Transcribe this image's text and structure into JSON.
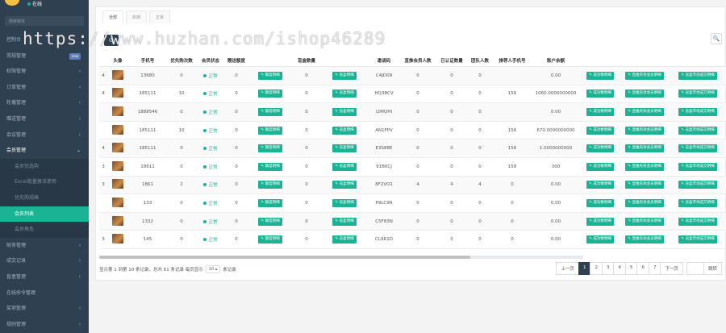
{
  "sidebar": {
    "status": "在线",
    "search_placeholder": "搜索菜单",
    "items": [
      {
        "label": "控制台",
        "arrow": ""
      },
      {
        "label": "常规管理",
        "badge": "new"
      },
      {
        "label": "权限管理",
        "arrow": "‹"
      },
      {
        "label": "订单管理",
        "arrow": "‹"
      },
      {
        "label": "轮播管理",
        "arrow": "‹"
      },
      {
        "label": "赠送管理",
        "arrow": "‹"
      },
      {
        "label": "会议管理",
        "arrow": "‹"
      },
      {
        "label": "会员管理",
        "arrow": "⌄",
        "open": true
      },
      {
        "label": "会员优选购",
        "sub": true
      },
      {
        "label": "Excel批量激活使用",
        "sub": true
      },
      {
        "label": "优先购规格",
        "sub": true
      },
      {
        "label": "会员列表",
        "sub": true,
        "active": true
      },
      {
        "label": "会员角色",
        "sub": true
      },
      {
        "label": "财务管理",
        "arrow": "‹"
      },
      {
        "label": "成交记录",
        "arrow": "‹"
      },
      {
        "label": "盲盒管理",
        "arrow": "‹"
      },
      {
        "label": "在线命令管理",
        "arrow": ""
      },
      {
        "label": "奖项管理",
        "arrow": "‹"
      },
      {
        "label": "规则管理",
        "arrow": "‹"
      }
    ]
  },
  "tabs": [
    "全部",
    "启用",
    "正常"
  ],
  "watermark": "https://www.huzhan.com/ishop46289",
  "table": {
    "headers": [
      "头像",
      "手机号",
      "优先购次数",
      "会员状态",
      "赠送额度",
      "",
      "盲盒数量",
      "",
      "邀请码",
      "直推会员人数",
      "已认证数量",
      "团队人数",
      "推荐人手机号",
      "账户余额",
      "",
      "",
      ""
    ],
    "buttons": {
      "quota": "额度明细",
      "box": "盲盒明细",
      "success": "成功数明细",
      "direct": "直推有效会员明细",
      "blindrec": "盲盒市场成交明细"
    },
    "rows": [
      {
        "idx": "4",
        "phone": "13680",
        "prior": "0",
        "status": "正常",
        "quota": "0",
        "box": "0",
        "code": "C4JD09",
        "direct": "0",
        "cert": "0",
        "team": "0",
        "ref": "",
        "balance": "0.00"
      },
      {
        "idx": "4",
        "phone": "185111",
        "prior": "10",
        "status": "正常",
        "quota": "0",
        "box": "0",
        "code": "HQ3BCV",
        "direct": "0",
        "cert": "0",
        "team": "0",
        "ref": "156",
        "balance": "1060.0000000000"
      },
      {
        "idx": "",
        "phone": "1888546",
        "prior": "0",
        "status": "正常",
        "quota": "0",
        "box": "0",
        "code": "I2MQHI",
        "direct": "0",
        "cert": "0",
        "team": "0",
        "ref": "",
        "balance": "0.00"
      },
      {
        "idx": "",
        "phone": "185111",
        "prior": "10",
        "status": "正常",
        "quota": "0",
        "box": "0",
        "code": "AN1FPV",
        "direct": "0",
        "cert": "0",
        "team": "0",
        "ref": "156",
        "balance": "670.0000000000"
      },
      {
        "idx": "4",
        "phone": "185111",
        "prior": "0",
        "status": "正常",
        "quota": "0",
        "box": "0",
        "code": "E3S88E",
        "direct": "0",
        "cert": "0",
        "team": "0",
        "ref": "156",
        "balance": "1.0000000000"
      },
      {
        "idx": "3",
        "phone": "18611",
        "prior": "0",
        "status": "正常",
        "quota": "0",
        "box": "0",
        "code": "91B0CJ",
        "direct": "0",
        "cert": "0",
        "team": "0",
        "ref": "158",
        "balance": "300"
      },
      {
        "idx": "3",
        "phone": "1861",
        "prior": "2",
        "status": "正常",
        "quota": "0",
        "box": "0",
        "code": "8F2VO1",
        "direct": "4",
        "cert": "4",
        "team": "4",
        "ref": "0",
        "balance": "0.00"
      },
      {
        "idx": "",
        "phone": "133",
        "prior": "0",
        "status": "正常",
        "quota": "0",
        "box": "0",
        "code": "P9LC9R",
        "direct": "0",
        "cert": "0",
        "team": "0",
        "ref": "0",
        "balance": "0.00"
      },
      {
        "idx": "",
        "phone": "1332",
        "prior": "0",
        "status": "正常",
        "quota": "0",
        "box": "0",
        "code": "C5F83N",
        "direct": "0",
        "cert": "0",
        "team": "0",
        "ref": "0",
        "balance": "0.00"
      },
      {
        "idx": "3",
        "phone": "145",
        "prior": "0",
        "status": "正常",
        "quota": "0",
        "box": "0",
        "code": "CL9R1D",
        "direct": "0",
        "cert": "0",
        "team": "0",
        "ref": "0",
        "balance": "0.00"
      }
    ]
  },
  "footer": {
    "summary": "显示第 1 到第 10 条记录，总共 61 条记录 每页显示",
    "page_size": "10 ▴",
    "suffix": "条记录",
    "prev": "上一页",
    "pages": [
      "1",
      "2",
      "3",
      "4",
      "5",
      "6",
      "7"
    ],
    "next": "下一页",
    "jump": "跳转"
  }
}
